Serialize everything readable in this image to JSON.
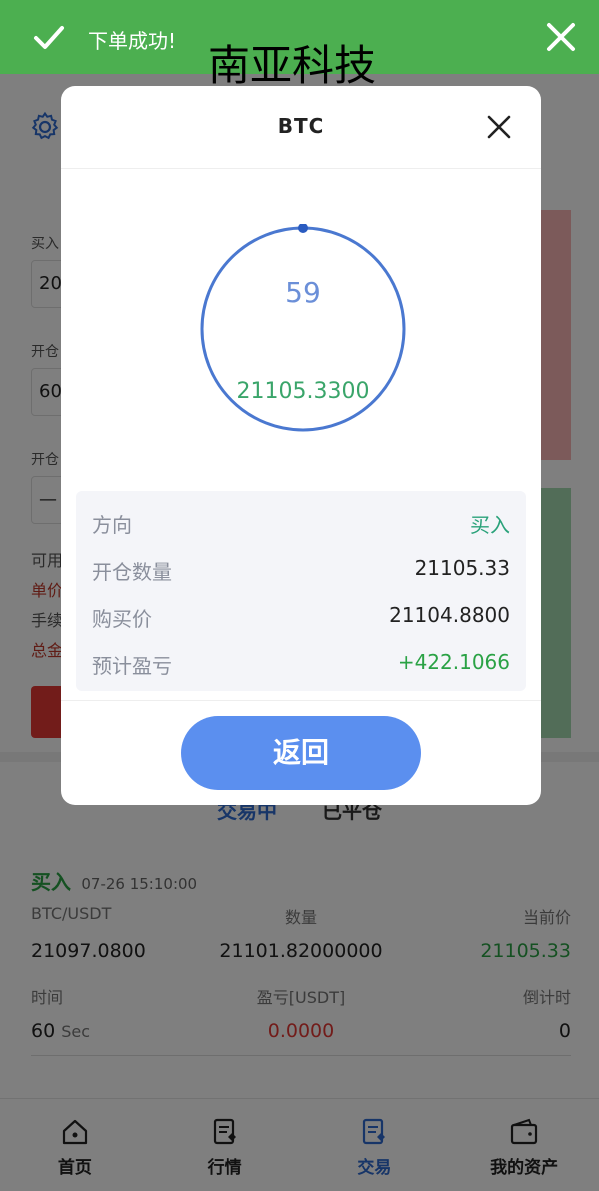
{
  "toast": {
    "message": "下单成功!"
  },
  "watermark": "南亚科技",
  "background_form": {
    "label1": "买入",
    "input1": "20",
    "label2": "开仓",
    "input2": "60",
    "label3": "开仓",
    "input3": "—",
    "line1": "可用",
    "line2": "单价",
    "line3": "手续",
    "line4": "总金"
  },
  "tabs": [
    {
      "label": "交易中"
    },
    {
      "label": "已平仓"
    }
  ],
  "order": {
    "direction": "买入",
    "time": "07-26 15:10:00",
    "headers1": [
      "BTC/USDT",
      "数量",
      "当前价"
    ],
    "values1": [
      "21097.0800",
      "21101.82000000",
      "21105.33"
    ],
    "headers2": [
      "时间",
      "盈亏[USDT]",
      "倒计时"
    ],
    "seconds": "60",
    "sec_unit": "Sec",
    "profit": "0.0000",
    "countdown": "0"
  },
  "bottom_nav": [
    {
      "label": "首页",
      "icon": "home-icon"
    },
    {
      "label": "行情",
      "icon": "market-icon"
    },
    {
      "label": "交易",
      "icon": "trade-icon"
    },
    {
      "label": "我的资产",
      "icon": "wallet-icon"
    }
  ],
  "modal": {
    "title": "BTC",
    "countdown_value": "59",
    "price": "21105.3300",
    "rows": [
      {
        "label": "方向",
        "value": "买入"
      },
      {
        "label": "开仓数量",
        "value": "21105.33"
      },
      {
        "label": "购买价",
        "value": "21104.8800"
      },
      {
        "label": "预计盈亏",
        "value": "+422.1066"
      }
    ],
    "back_label": "返回"
  },
  "colors": {
    "success_green": "#4caf50",
    "primary_blue": "#5b8fef",
    "profit_green": "#2aa245",
    "loss_red": "#e53935"
  }
}
